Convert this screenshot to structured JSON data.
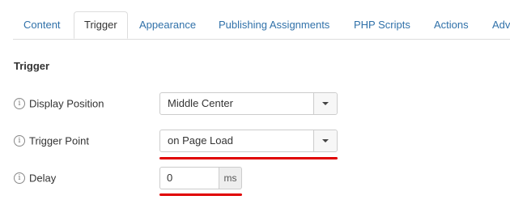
{
  "tabs": [
    {
      "label": "Content",
      "active": false
    },
    {
      "label": "Trigger",
      "active": true
    },
    {
      "label": "Appearance",
      "active": false
    },
    {
      "label": "Publishing Assignments",
      "active": false
    },
    {
      "label": "PHP Scripts",
      "active": false
    },
    {
      "label": "Actions",
      "active": false
    },
    {
      "label": "Adv",
      "active": false
    }
  ],
  "section": {
    "title": "Trigger"
  },
  "fields": {
    "display_position": {
      "label": "Display Position",
      "info_icon": "i",
      "value": "Middle Center"
    },
    "trigger_point": {
      "label": "Trigger Point",
      "info_icon": "i",
      "value": "on Page Load"
    },
    "delay": {
      "label": "Delay",
      "info_icon": "i",
      "value": "0",
      "unit": "ms"
    }
  },
  "colors": {
    "link": "#3071a9",
    "highlight": "#e00000"
  }
}
